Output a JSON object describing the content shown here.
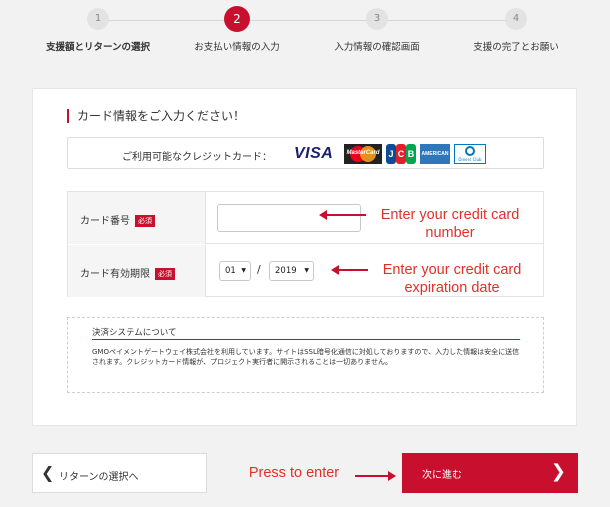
{
  "stepper": {
    "steps": [
      {
        "number": "1",
        "label": "支援額とリターンの選択"
      },
      {
        "number": "2",
        "label": "お支払い情報の入力"
      },
      {
        "number": "3",
        "label": "入力情報の確認画面"
      },
      {
        "number": "4",
        "label": "支援の完了とお願い"
      }
    ]
  },
  "card_section": {
    "title": "カード情報をご入力ください！",
    "brands_label": "ご利用可能なクレジットカード：",
    "brands": [
      "VISA",
      "MasterCard",
      "JCB",
      "American Express",
      "Diners Club"
    ],
    "logo_text": {
      "visa": "VISA",
      "mastercard": "MasterCard",
      "jcb_j": "J",
      "jcb_c": "C",
      "jcb_b": "B",
      "amex": "AMERICAN EXPRESS",
      "diners": "Diners Club"
    }
  },
  "form": {
    "card_number_label": "カード番号",
    "expiry_label": "カード有効期限",
    "required_badge": "必須",
    "card_number_value": "",
    "expiry_month": "01",
    "expiry_separator": "/",
    "expiry_year": "2019"
  },
  "annotations": {
    "card_number": "Enter your credit card number",
    "expiry": "Enter your credit card expiration date",
    "submit": "Press to enter"
  },
  "info": {
    "title": "決済システムについて",
    "body": "GMOペイメントゲートウェイ株式会社を利用しています。サイトはSSL暗号化通信に対処しておりますので、入力した情報は安全に送信されます。クレジットカード情報が、プロジェクト実行者に開示されることは一切ありません。"
  },
  "footer": {
    "back_label": "リターンの選択へ",
    "next_label": "次に進む"
  },
  "colors": {
    "accent": "#c8102e",
    "annotation": "#e0302a",
    "background": "#f2f2f2"
  }
}
